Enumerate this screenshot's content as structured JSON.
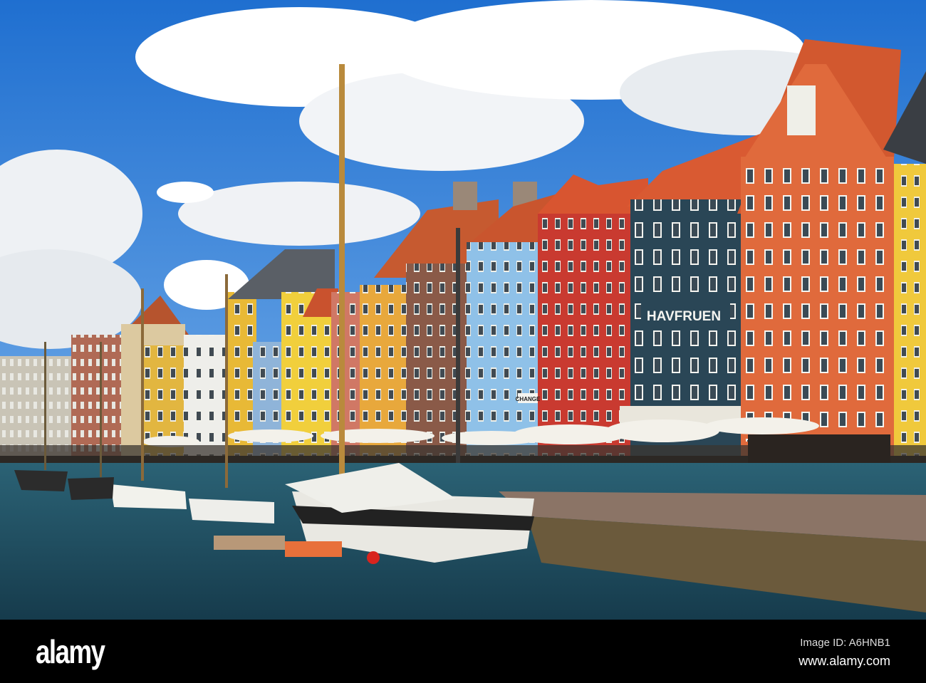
{
  "photo": {
    "signs": {
      "hotel": "HAVFRUEN",
      "exchange": "CHANGE"
    }
  },
  "footer": {
    "logo": "alamy",
    "image_id": "Image ID: A6HNB1",
    "website": "www.alamy.com"
  },
  "colors": {
    "sky": "#2f7fd6",
    "water": "#1d4a5e",
    "footer": "#000000"
  }
}
